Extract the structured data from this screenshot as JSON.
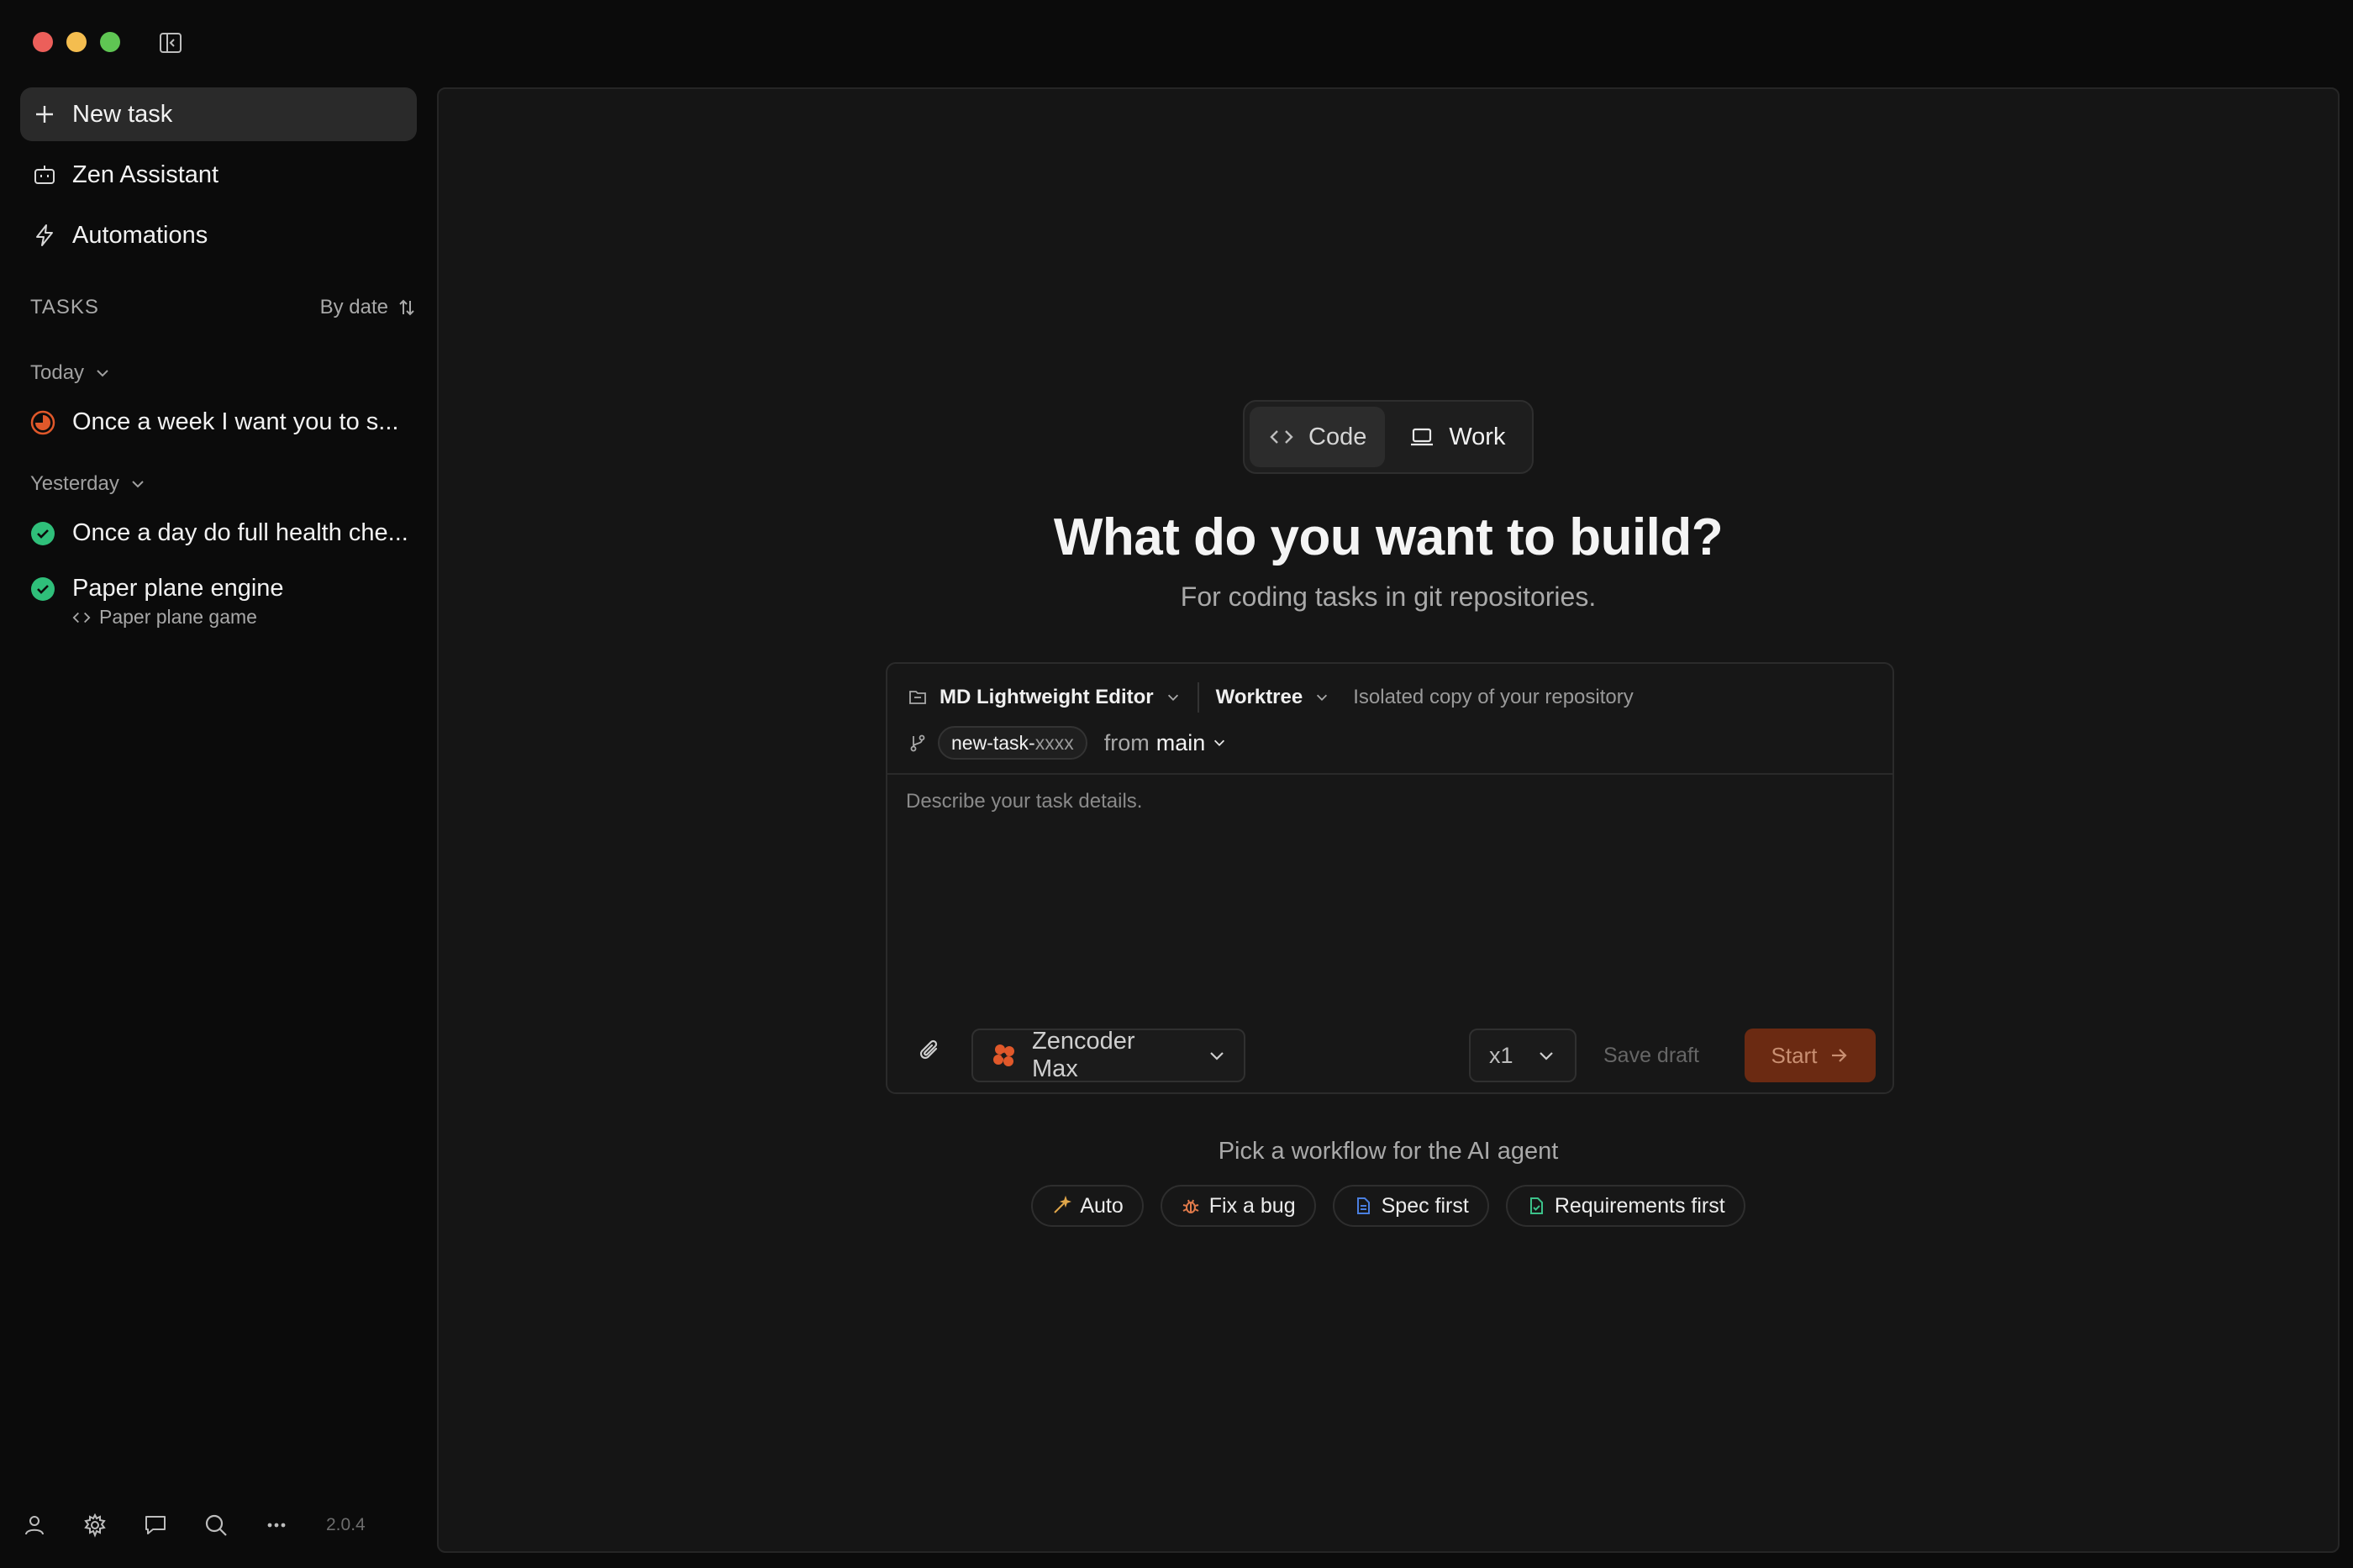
{
  "sidebar": {
    "new_task": "New task",
    "assistant": "Zen Assistant",
    "automations": "Automations",
    "tasks_header": "TASKS",
    "sort_label": "By date",
    "groups": [
      {
        "label": "Today",
        "tasks": [
          {
            "name": "Once a week I want you to s...",
            "status": "in-progress"
          }
        ]
      },
      {
        "label": "Yesterday",
        "tasks": [
          {
            "name": "Once a day do full health che...",
            "status": "done"
          },
          {
            "name": "Paper plane engine",
            "subtitle": "Paper plane game",
            "status": "done"
          }
        ]
      }
    ],
    "version": "2.0.4"
  },
  "main": {
    "modes": {
      "code": "Code",
      "work": "Work"
    },
    "headline": "What do you want to build?",
    "subheadline": "For coding tasks in git repositories.",
    "composer": {
      "repo": "MD Lightweight Editor",
      "worktree": "Worktree",
      "worktree_hint": "Isolated copy of your repository",
      "branch_name": "new-task-",
      "branch_suffix": "xxxx",
      "from_label": "from",
      "from_branch": "main",
      "placeholder": "Describe your task details.",
      "model": "Zencoder Max",
      "multiplier": "x1",
      "save_draft": "Save draft",
      "start": "Start"
    },
    "workflow_label": "Pick a workflow for the AI agent",
    "workflows": [
      {
        "label": "Auto",
        "icon": "wand-icon",
        "color": "#e0a64a"
      },
      {
        "label": "Fix a bug",
        "icon": "bug-icon",
        "color": "#e07a4a"
      },
      {
        "label": "Spec first",
        "icon": "document-icon",
        "color": "#4a7fe0"
      },
      {
        "label": "Requirements first",
        "icon": "document-check-icon",
        "color": "#3cc28a"
      }
    ]
  },
  "colors": {
    "accent_orange": "#e0582a",
    "success_green": "#2fbf7a",
    "start_button": "#6b2a12"
  }
}
